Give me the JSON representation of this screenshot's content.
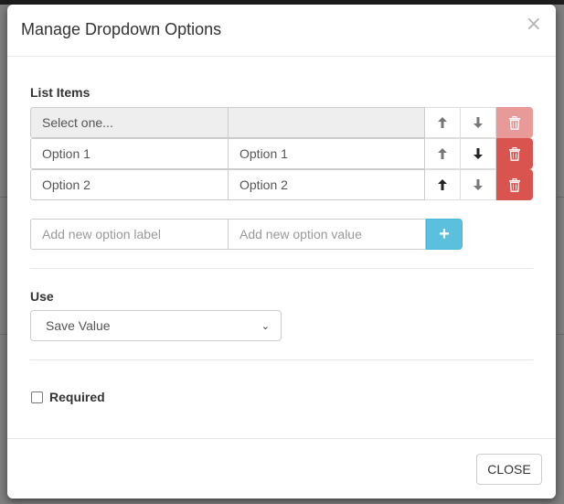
{
  "modal": {
    "title": "Manage Dropdown Options",
    "close_icon": "×"
  },
  "list_items": {
    "heading": "List Items",
    "rows": [
      {
        "label": "Select one...",
        "value": "",
        "disabled": true
      },
      {
        "label": "Option 1",
        "value": "Option 1",
        "disabled": false
      },
      {
        "label": "Option 2",
        "value": "Option 2",
        "disabled": false
      }
    ],
    "icons": {
      "up": "arrow-up-icon",
      "down": "arrow-down-icon",
      "delete": "trash-icon"
    }
  },
  "new_option": {
    "label_placeholder": "Add new option label",
    "value_placeholder": "Add new option value",
    "add_symbol": "+"
  },
  "use": {
    "heading": "Use",
    "selected": "Save Value"
  },
  "required": {
    "label": "Required",
    "checked": false
  },
  "footer": {
    "close_label": "CLOSE"
  },
  "colors": {
    "danger": "#d9534f",
    "info": "#5bc0de"
  }
}
